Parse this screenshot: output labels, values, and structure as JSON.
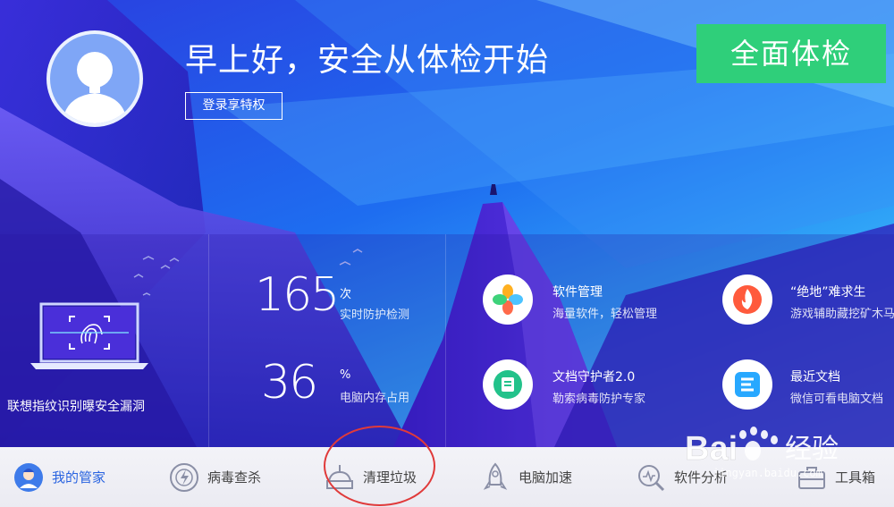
{
  "header": {
    "greeting": "早上好，安全从体检开始",
    "login_label": "登录享特权",
    "scan_label": "全面体检"
  },
  "fingerprint": {
    "label": "联想指纹识别曝安全漏洞"
  },
  "stats": [
    {
      "value": "165",
      "unit": "次",
      "desc": "实时防护检测"
    },
    {
      "value": "36",
      "unit": "%",
      "desc": "电脑内存占用"
    }
  ],
  "features": [
    {
      "title": "软件管理",
      "sub": "海量软件，轻松管理",
      "icon": "clover-icon"
    },
    {
      "title": "“绝地”难求生",
      "sub": "游戏辅助藏挖矿木马",
      "icon": "flame-icon"
    },
    {
      "title": "文档守护者2.0",
      "sub": "勒索病毒防护专家",
      "icon": "document-shield-icon"
    },
    {
      "title": "最近文档",
      "sub": "微信可看电脑文档",
      "icon": "recent-docs-icon"
    }
  ],
  "nav": [
    {
      "label": "我的管家",
      "icon": "butler-icon",
      "active": true
    },
    {
      "label": "病毒查杀",
      "icon": "virus-scan-icon"
    },
    {
      "label": "清理垃圾",
      "icon": "cleanup-icon"
    },
    {
      "label": "电脑加速",
      "icon": "rocket-icon"
    },
    {
      "label": "软件分析",
      "icon": "software-analysis-icon"
    },
    {
      "label": "工具箱",
      "icon": "toolbox-icon"
    }
  ],
  "colors": {
    "accent_green": "#2fcf7a",
    "active_nav": "#2a64e0",
    "annotation": "#e03a3a"
  },
  "watermark": {
    "brand": "Bai经验",
    "url": "jingyan.baidu.com"
  }
}
